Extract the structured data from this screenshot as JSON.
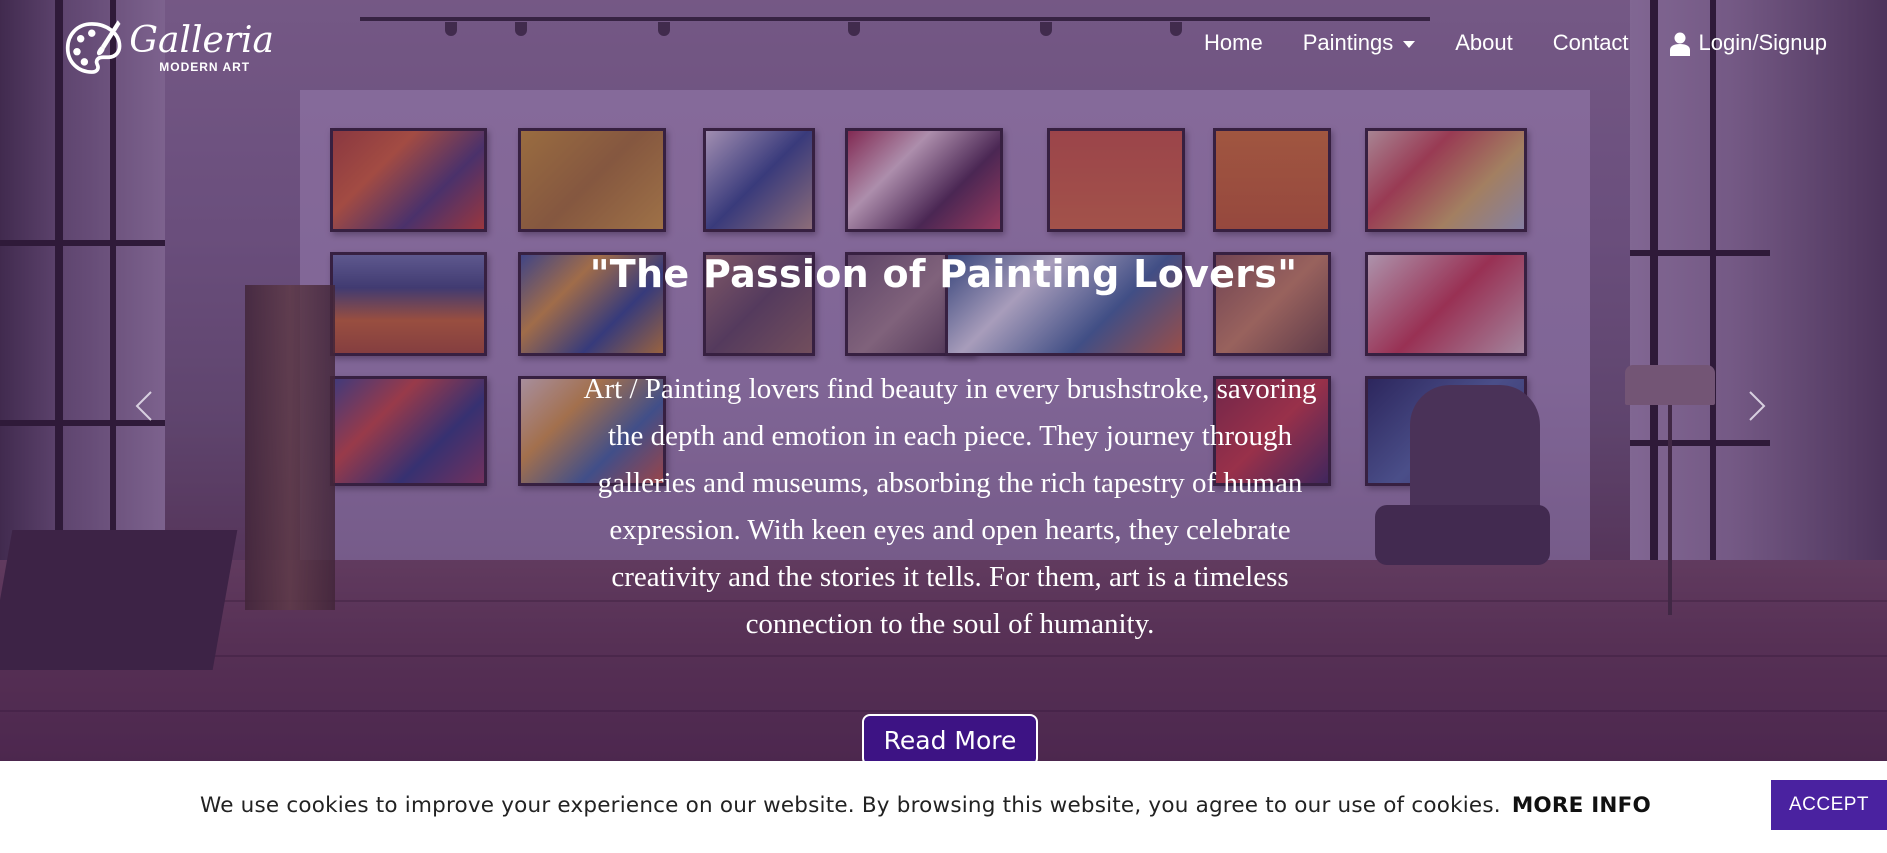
{
  "brand": {
    "logo_name": "Galleria",
    "logo_subtitle": "MODERN ART",
    "logo_icon": "palette-brush-icon"
  },
  "nav": {
    "items": [
      {
        "label": "Home"
      },
      {
        "label": "Paintings",
        "has_dropdown": true
      },
      {
        "label": "About"
      },
      {
        "label": "Contact"
      }
    ],
    "login_label": "Login/Signup",
    "login_icon": "user-icon"
  },
  "carousel": {
    "title": "\"The Passion of Painting Lovers\"",
    "text": "Art / Painting lovers find beauty in every brushstroke, savoring the depth and emotion in each piece. They journey through galleries and museums, absorbing the rich tapestry of human expression. With keen eyes and open hearts, they celebrate creativity and the stories it tells. For them, art is a timeless connection to the soul of humanity.",
    "button_label": "Read More",
    "prev_icon": "chevron-left-icon",
    "next_icon": "chevron-right-icon"
  },
  "cookie": {
    "text": "We use cookies to improve your experience on our website. By browsing this website, you agree to our use of cookies.",
    "more_info": "MORE INFO",
    "accept_label": "ACCEPT"
  },
  "colors": {
    "overlay": "#4b2364",
    "button_bg": "#3d1384",
    "accept_bg": "#4a22a0",
    "text_light": "#ffffff"
  }
}
